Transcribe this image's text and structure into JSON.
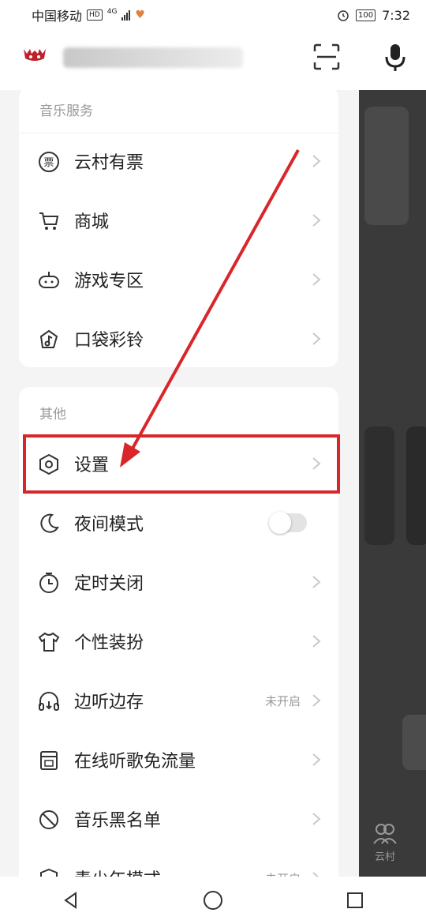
{
  "status_bar": {
    "carrier": "中国移动",
    "hd_badge": "HD",
    "network": "4G",
    "battery": "100",
    "time": "7:32"
  },
  "music_services": {
    "title": "音乐服务",
    "items": [
      {
        "label": "云村有票",
        "icon": "ticket-icon"
      },
      {
        "label": "商城",
        "icon": "cart-icon"
      },
      {
        "label": "游戏专区",
        "icon": "gamepad-icon"
      },
      {
        "label": "口袋彩铃",
        "icon": "ringtone-icon"
      }
    ]
  },
  "other": {
    "title": "其他",
    "items": [
      {
        "label": "设置",
        "icon": "settings-icon"
      },
      {
        "label": "夜间模式",
        "icon": "moon-icon",
        "toggle": false
      },
      {
        "label": "定时关闭",
        "icon": "timer-icon"
      },
      {
        "label": "个性装扮",
        "icon": "tshirt-icon"
      },
      {
        "label": "边听边存",
        "icon": "headphones-icon",
        "sub": "未开启"
      },
      {
        "label": "在线听歌免流量",
        "icon": "sim-card-icon"
      },
      {
        "label": "音乐黑名单",
        "icon": "block-icon"
      },
      {
        "label": "青少年模式",
        "icon": "shield-icon",
        "sub": "未开启"
      }
    ]
  },
  "background_tab": {
    "label": "云村"
  },
  "colors": {
    "highlight": "#d9262a",
    "accent": "#e8282b"
  }
}
